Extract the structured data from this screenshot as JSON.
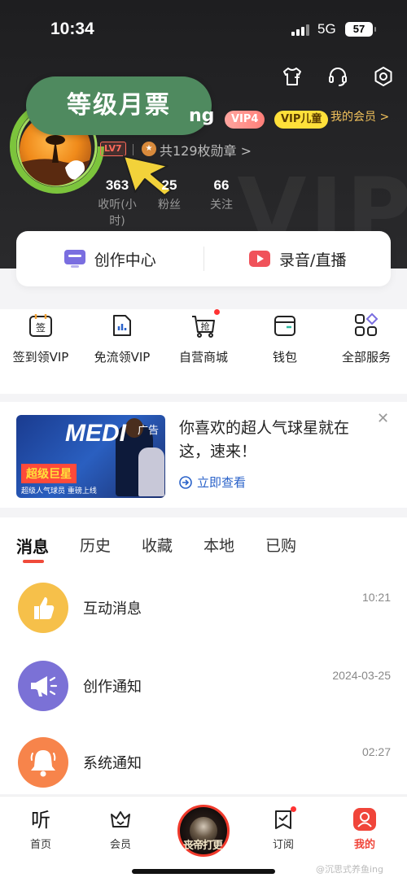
{
  "status_bar": {
    "time": "10:34",
    "network": "5G",
    "battery": "57"
  },
  "profile": {
    "nickname_partial": "ng",
    "badge_vip4": "VIP4",
    "badge_vip_kids": "VIP儿童",
    "my_member": "我的会员 >",
    "level": "LV7",
    "medals": "共129枚勋章 >",
    "stats": [
      {
        "value": "363",
        "label": "收听(小时)"
      },
      {
        "value": "25",
        "label": "粉丝"
      },
      {
        "value": "66",
        "label": "关注"
      }
    ]
  },
  "overlay_tag": "等级月票",
  "create_card": {
    "left": "创作中心",
    "right": "录音/直播"
  },
  "services": [
    {
      "label": "签到领VIP",
      "icon": "sign-in-icon"
    },
    {
      "label": "免流领VIP",
      "icon": "data-free-icon"
    },
    {
      "label": "自营商城",
      "icon": "mall-icon",
      "badge": true
    },
    {
      "label": "钱包",
      "icon": "wallet-icon"
    },
    {
      "label": "全部服务",
      "icon": "all-services-icon"
    }
  ],
  "ad": {
    "image_title": "MEDI",
    "image_tag": "超级巨星",
    "image_sub": "超级人气球员 重磅上线",
    "mark": "广告",
    "title": "你喜欢的超人气球星就在这，速来！",
    "link": "立即查看"
  },
  "tabs": [
    "消息",
    "历史",
    "收藏",
    "本地",
    "已购"
  ],
  "messages": [
    {
      "title": "互动消息",
      "time": "10:21",
      "color": "#f6c04a",
      "icon": "thumbs-up-icon"
    },
    {
      "title": "创作通知",
      "time": "2024-03-25",
      "color": "#7b71d6",
      "icon": "megaphone-icon"
    },
    {
      "title": "系统通知",
      "time": "02:27",
      "color": "#f7844b",
      "icon": "bell-icon"
    }
  ],
  "tabbar": {
    "home": "首页",
    "member": "会员",
    "player_cover_text": "丧帝打更",
    "subscribe": "订阅",
    "mine": "我的"
  },
  "watermark": "@沉思式养鱼ing",
  "colors": {
    "accent": "#f04a3a",
    "link": "#2a62c9",
    "gold": "#f3c35c"
  }
}
